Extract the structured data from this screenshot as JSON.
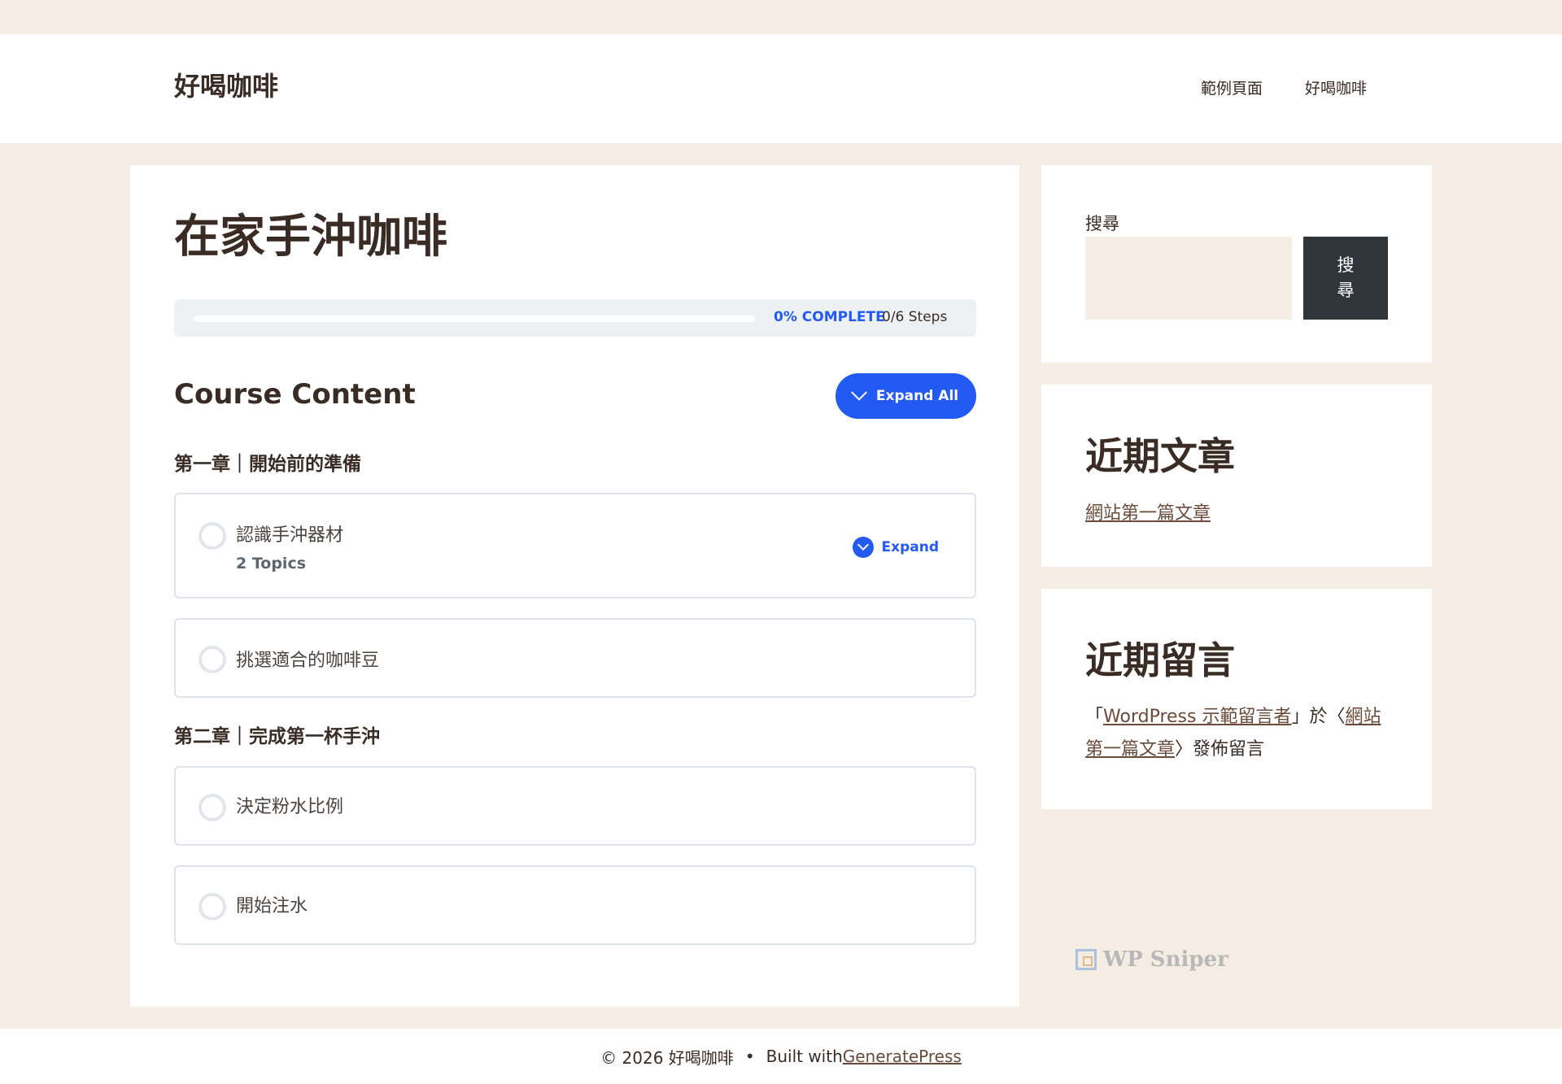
{
  "header": {
    "site_title": "好喝咖啡",
    "nav": [
      "範例頁面",
      "好喝咖啡"
    ]
  },
  "course": {
    "title": "在家手沖咖啡",
    "progress": {
      "percent": 0,
      "status_label": "0% COMPLETE",
      "steps_label": "0/6 Steps"
    },
    "content_heading": "Course Content",
    "expand_all_label": "Expand All",
    "sections": [
      {
        "heading": "第一章｜開始前的準備",
        "lessons": [
          {
            "title": "認識手沖器材",
            "topics_label": "2 Topics",
            "expand_label": "Expand"
          },
          {
            "title": "挑選適合的咖啡豆"
          }
        ]
      },
      {
        "heading": "第二章｜完成第一杯手沖",
        "lessons": [
          {
            "title": "決定粉水比例"
          },
          {
            "title": "開始注水"
          }
        ]
      }
    ]
  },
  "sidebar": {
    "search": {
      "label": "搜尋",
      "placeholder": "",
      "button_label": "搜\n尋"
    },
    "recent_posts": {
      "title": "近期文章",
      "items": [
        "網站第一篇文章"
      ]
    },
    "recent_comments": {
      "title": "近期留言",
      "items": [
        {
          "open_quote": "「",
          "author": "WordPress 示範留言者",
          "mid_text": "」於〈",
          "post": "網站第一篇文章",
          "end_text": "〉發佈留言"
        }
      ]
    }
  },
  "watermark": {
    "text": "WP Sniper"
  },
  "footer": {
    "copyright": "© 2026 好喝咖啡",
    "separator": "•",
    "built_with": "Built with ",
    "theme_link": "GeneratePress"
  },
  "colors": {
    "accent": "#235af3",
    "page_bg": "#f5ede3",
    "text": "#3a2c24",
    "search_button": "#31363b"
  }
}
